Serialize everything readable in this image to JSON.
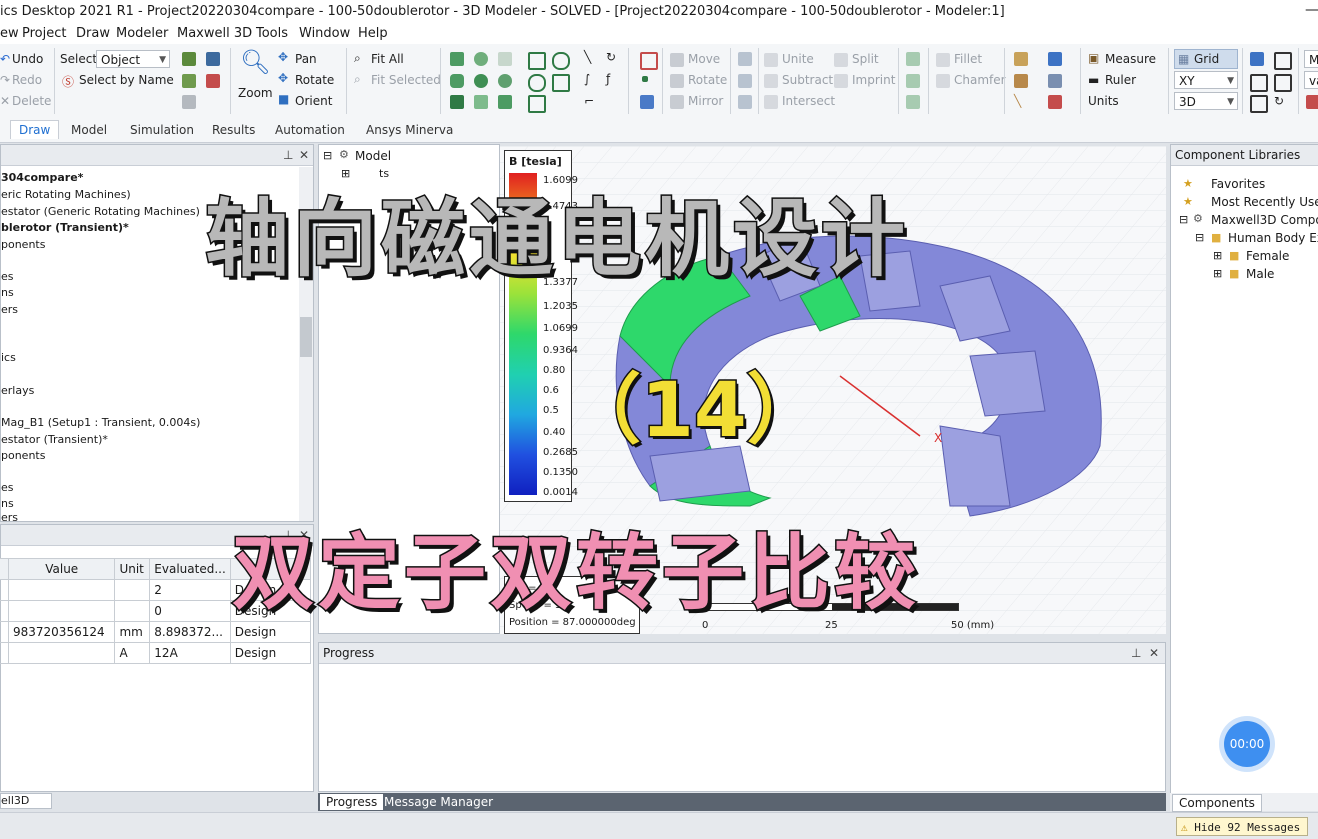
{
  "titlebar": {
    "title": "ics Desktop 2021 R1 - Project20220304compare - 100-50doublerotor - 3D Modeler - SOLVED - [Project20220304compare - 100-50doublerotor - Modeler:1]"
  },
  "menu": [
    "ew",
    "Project",
    "Draw",
    "Modeler",
    "Maxwell 3D",
    "Tools",
    "Window",
    "Help"
  ],
  "ribbon": {
    "undo": "Undo",
    "redo": "Redo",
    "delete": "Delete",
    "select_label": "Select:",
    "select_value": "Object",
    "select_by_name": "Select by Name",
    "zoom": "Zoom",
    "pan": "Pan",
    "rotate": "Rotate",
    "orient": "Orient",
    "fit_all": "Fit All",
    "fit_selected": "Fit Selected",
    "move": "Move",
    "rotate2": "Rotate",
    "mirror": "Mirror",
    "unite": "Unite",
    "subtract": "Subtract",
    "intersect": "Intersect",
    "split": "Split",
    "imprint": "Imprint",
    "fillet": "Fillet",
    "chamfer": "Chamfer",
    "measure": "Measure",
    "ruler": "Ruler",
    "units": "Units",
    "grid": "Grid",
    "plane": "XY",
    "mode": "3D",
    "cut1": "Ma",
    "cut2": "va"
  },
  "tabs": [
    "Draw",
    "Model",
    "Simulation",
    "Results",
    "Automation",
    "Ansys Minerva"
  ],
  "project_tree": [
    {
      "text": "304compare*",
      "bold": true
    },
    {
      "text": "eric Rotating Machines)",
      "bold": false
    },
    {
      "text": "estator (Generic Rotating Machines)",
      "bold": false
    },
    {
      "text": "blerotor (Transient)*",
      "bold": true
    },
    {
      "text": "ponents",
      "bold": false
    },
    {
      "text": "es",
      "bold": false
    },
    {
      "text": "ns",
      "bold": false
    },
    {
      "text": "ers",
      "bold": false
    },
    {
      "text": "ics",
      "bold": false
    },
    {
      "text": "erlays",
      "bold": false
    },
    {
      "text": "Mag_B1 (Setup1 : Transient, 0.004s)",
      "bold": false
    },
    {
      "text": "estator (Transient)*",
      "bold": false
    },
    {
      "text": "ponents",
      "bold": false
    },
    {
      "text": "es",
      "bold": false
    },
    {
      "text": "ns",
      "bold": false
    },
    {
      "text": "ers",
      "bold": false
    }
  ],
  "properties": {
    "headers": [
      "",
      "Value",
      "Unit",
      "Evaluated...",
      ""
    ],
    "rows": [
      [
        "",
        "",
        "",
        "2",
        "Design"
      ],
      [
        "",
        "",
        "",
        "0",
        "Design"
      ],
      [
        "",
        "983720356124",
        "mm",
        "8.898372...",
        "Design"
      ],
      [
        "",
        "",
        "A",
        "12A",
        "Design"
      ]
    ]
  },
  "model_tree": {
    "root": "Model",
    "child": "ts"
  },
  "legend": {
    "title": "B [tesla]",
    "values": [
      "1.6099",
      "1.4743",
      "1.3377",
      "1.2035",
      "1.0699",
      "0.9364",
      "0.80",
      "0.6",
      "0.5",
      "0.40",
      "0.2685",
      "0.1350",
      "0.0014"
    ]
  },
  "anim": {
    "time": "me   =",
    "speed": "Speed   = 3",
    "position": "Position = 87.000000deg"
  },
  "scale": {
    "t0": "0",
    "t1": "25",
    "t2": "50 (mm)"
  },
  "overlay": {
    "line1": "轴向磁通电机设计",
    "line2": "（14）",
    "line3": "双定子双转子比较"
  },
  "progress": {
    "title": "Progress"
  },
  "bottom_tabs": {
    "progress": "Progress",
    "messages": "Message Manager",
    "left": "ell3D",
    "components": "Components"
  },
  "component_libraries": {
    "title": "Component Libraries",
    "items": [
      {
        "text": "Favorites",
        "level": 1
      },
      {
        "text": "Most Recently Use",
        "level": 1
      },
      {
        "text": "Maxwell3D Compo",
        "level": 1
      },
      {
        "text": "Human Body Ex",
        "level": 2
      },
      {
        "text": "Female",
        "level": 3
      },
      {
        "text": "Male",
        "level": 3
      }
    ]
  },
  "timer": "00:00",
  "hide_messages": "Hide 92 Messages",
  "colors": {
    "accent": "#1f6fd1",
    "mesh": "#7e82d9",
    "field_green": "#2ed86b"
  }
}
